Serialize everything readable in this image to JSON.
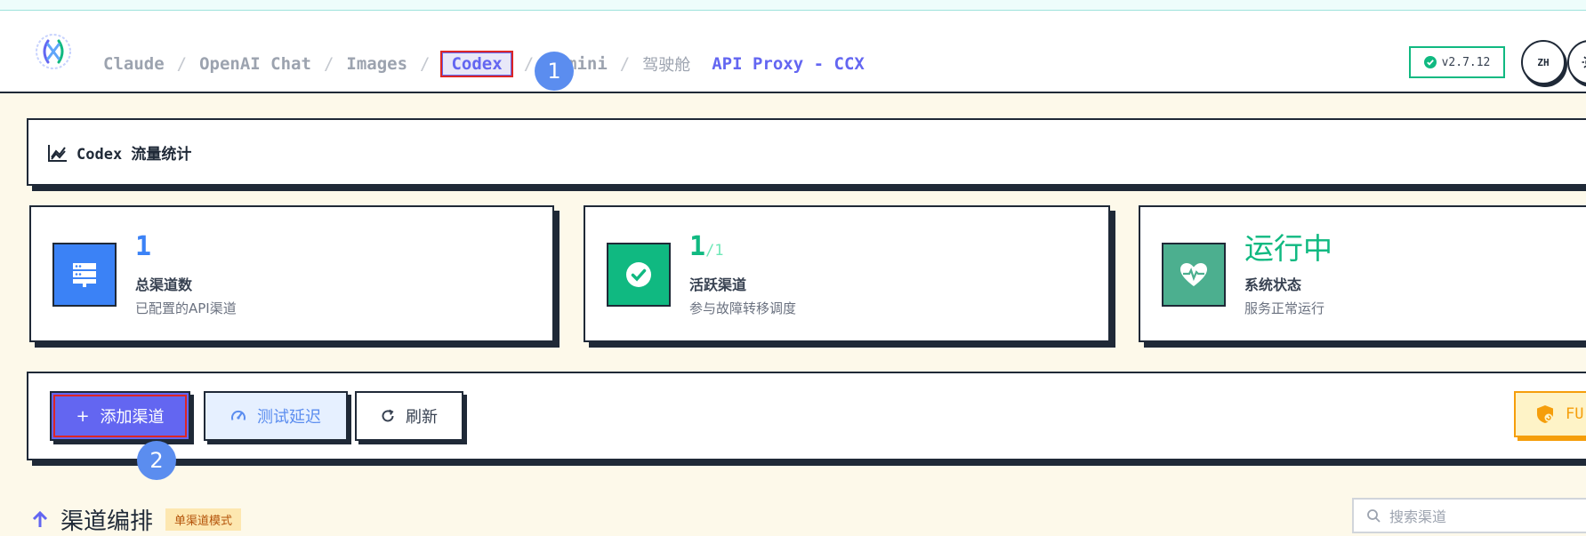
{
  "nav": {
    "crumbs": [
      "Claude",
      "OpenAI Chat",
      "Images",
      "Codex",
      "Gemini",
      "驾驶舱"
    ],
    "separator": "/",
    "brand": "API Proxy - CCX",
    "version": "v2.7.12",
    "lang": "ZH"
  },
  "markers": {
    "one": "1",
    "two": "2"
  },
  "traffic": {
    "title": "Codex 流量统计"
  },
  "cards": [
    {
      "value": "1",
      "label": "总渠道数",
      "sub": "已配置的API渠道"
    },
    {
      "value": "1",
      "total": "/1",
      "label": "活跃渠道",
      "sub": "参与故障转移调度"
    },
    {
      "value": "运行中",
      "label": "系统状态",
      "sub": "服务正常运行"
    }
  ],
  "actions": {
    "add": "添加渠道",
    "test": "测试延迟",
    "refresh": "刷新",
    "fu": "FU"
  },
  "section": {
    "title": "渠道编排",
    "mode": "单渠道模式"
  },
  "search": {
    "placeholder": "搜索渠道"
  },
  "colors": {
    "accent": "#6366f1",
    "success": "#10b981",
    "blue": "#3b82f6",
    "teal": "#4caf8f",
    "warn": "#f59e0b"
  }
}
